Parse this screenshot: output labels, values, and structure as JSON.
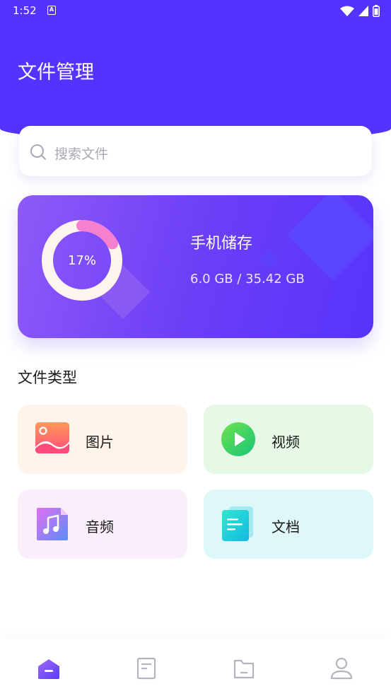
{
  "status_bar": {
    "time": "1:52",
    "notification_icon": "A",
    "icons": [
      "wifi-icon",
      "signal-icon",
      "battery-icon"
    ]
  },
  "header": {
    "title": "文件管理",
    "background_color": "#5233ff"
  },
  "search": {
    "placeholder": "搜索文件",
    "icon": "search-icon"
  },
  "storage": {
    "percent_label": "17%",
    "percent_used": 0.17,
    "title": "手机储存",
    "usage": "6.0 GB / 35.42 GB",
    "ring_color": "#f77fd0",
    "track_color": "#fff5ef"
  },
  "file_types": {
    "section_title": "文件类型",
    "items": [
      {
        "label": "图片",
        "icon": "image-icon",
        "tile_color": "#fff4ea"
      },
      {
        "label": "视频",
        "icon": "video-play-icon",
        "tile_color": "#e6f8e6"
      },
      {
        "label": "音频",
        "icon": "music-note-icon",
        "tile_color": "#fbeefb"
      },
      {
        "label": "文档",
        "icon": "document-icon",
        "tile_color": "#def7f9"
      }
    ]
  },
  "bottom_nav": {
    "items": [
      {
        "icon": "home-icon",
        "active": true
      },
      {
        "icon": "document-list-icon",
        "active": false
      },
      {
        "icon": "folder-icon",
        "active": false
      },
      {
        "icon": "profile-icon",
        "active": false
      }
    ],
    "active_color": "#6a3ff5",
    "inactive_color": "#b4b4be"
  }
}
